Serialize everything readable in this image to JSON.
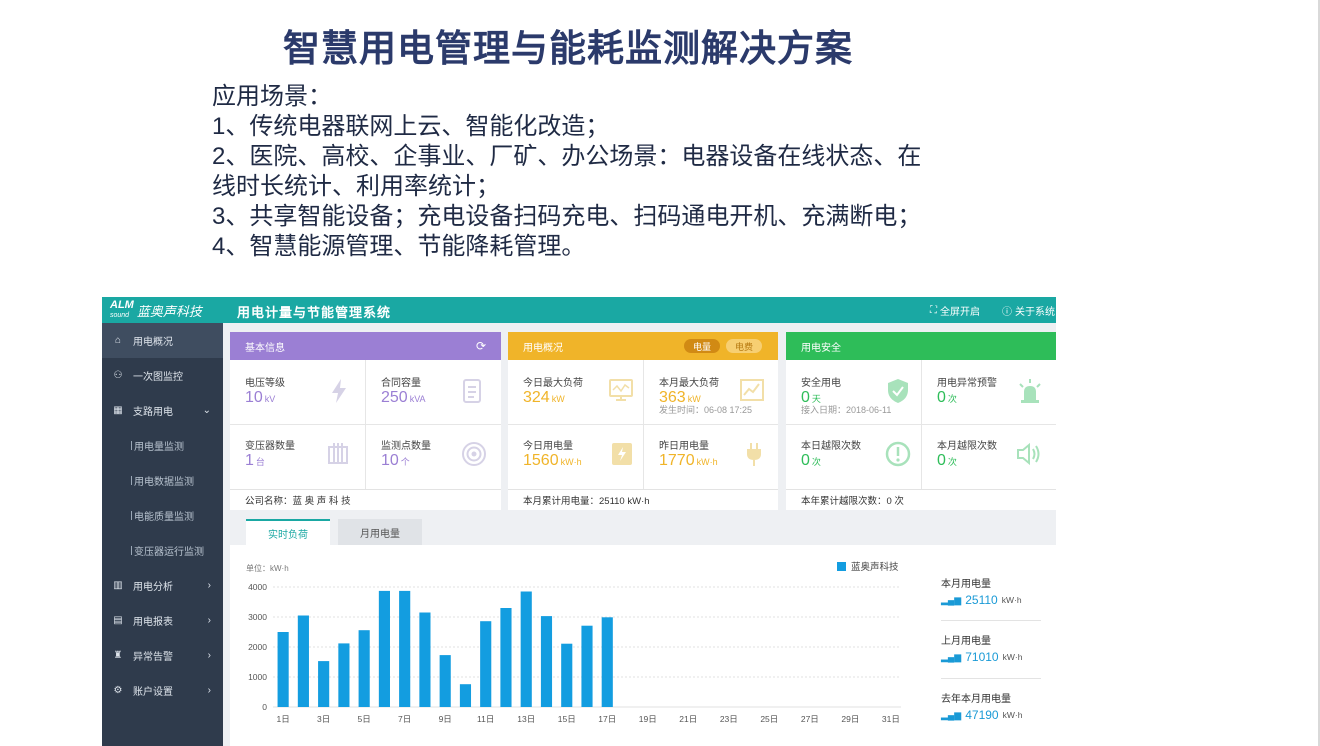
{
  "slide": {
    "title": "智慧用电管理与能耗监测解决方案",
    "lines": [
      "应用场景：",
      "1、传统电器联网上云、智能化改造；",
      "2、医院、高校、企事业、厂矿、办公场景：电器设备在线状态、在",
      "线时长统计、利用率统计；",
      "3、共享智能设备；充电设备扫码充电、扫码通电开机、充满断电；",
      "4、智慧能源管理、节能降耗管理。"
    ]
  },
  "app": {
    "brand_alm": "ALM",
    "brand_sub": "sound",
    "brand_name": "蓝奥声科技",
    "title": "用电计量与节能管理系统",
    "fullscreen": "全屏开启",
    "about": "关于系统"
  },
  "sidebar": {
    "items": [
      {
        "label": "用电概况",
        "icon": "home-icon"
      },
      {
        "label": "一次图监控",
        "icon": "diagram-icon"
      },
      {
        "label": "支路用电",
        "icon": "building-icon"
      },
      {
        "label": "用电量监测"
      },
      {
        "label": "用电数据监测"
      },
      {
        "label": "电能质量监测"
      },
      {
        "label": "变压器运行监测"
      },
      {
        "label": "用电分析",
        "icon": "bar-chart-icon"
      },
      {
        "label": "用电报表",
        "icon": "report-icon"
      },
      {
        "label": "异常告警",
        "icon": "alarm-icon"
      },
      {
        "label": "账户设置",
        "icon": "settings-icon"
      }
    ]
  },
  "basic": {
    "title": "基本信息",
    "color": "#9b7fd4",
    "voltage": {
      "label": "电压等级",
      "value": "10",
      "unit": "kV"
    },
    "contract": {
      "label": "合同容量",
      "value": "250",
      "unit": "kVA"
    },
    "transformer": {
      "label": "变压器数量",
      "value": "1",
      "unit": "台"
    },
    "points": {
      "label": "监测点数量",
      "value": "10",
      "unit": "个"
    },
    "company_label": "公司名称：",
    "company": "蓝 奥 声 科 技"
  },
  "usage": {
    "title": "用电概况",
    "color": "#f0b429",
    "pill_amount": "电量",
    "pill_fee": "电费",
    "today_max": {
      "label": "今日最大负荷",
      "value": "324",
      "unit": "kW"
    },
    "month_max": {
      "label": "本月最大负荷",
      "value": "363",
      "unit": "kW",
      "sub": "发生时间：06-08  17:25"
    },
    "today_use": {
      "label": "今日用电量",
      "value": "1560",
      "unit": "kW·h"
    },
    "yesterday_use": {
      "label": "昨日用电量",
      "value": "1770",
      "unit": "kW·h"
    },
    "footer": "本月累计用电量：25110 kW·h"
  },
  "safety": {
    "title": "用电安全",
    "color": "#2ebd59",
    "safe": {
      "label": "安全用电",
      "value": "0",
      "unit": "天",
      "sub": "接入日期：2018-06-11"
    },
    "abnormal": {
      "label": "用电异常预警",
      "value": "0",
      "unit": "次"
    },
    "day_over": {
      "label": "本日越限次数",
      "value": "0",
      "unit": "次"
    },
    "month_over": {
      "label": "本月越限次数",
      "value": "0",
      "unit": "次"
    },
    "footer": "本年累计越限次数：0 次"
  },
  "chart_tabs": {
    "realtime": "实时负荷",
    "monthly": "月用电量"
  },
  "stats": {
    "this_month": {
      "label": "本月用电量",
      "value": "25110",
      "unit": "kW·h"
    },
    "last_month": {
      "label": "上月用电量",
      "value": "71010",
      "unit": "kW·h"
    },
    "last_year": {
      "label": "去年本月用电量",
      "value": "47190",
      "unit": "kW·h"
    }
  },
  "chart_data": {
    "type": "bar",
    "ylabel": "单位：kW·h",
    "ylim": [
      0,
      4000
    ],
    "yticks": [
      0,
      1000,
      2000,
      3000,
      4000
    ],
    "grid": true,
    "legend_position": "top-right",
    "series": [
      {
        "name": "蓝奥声科技",
        "color": "#139de0",
        "values": [
          2500,
          3050,
          1530,
          2120,
          2560,
          3870,
          3870,
          3150,
          1730,
          760,
          2860,
          3300,
          3850,
          3030,
          2110,
          2710,
          2990,
          null,
          null,
          null,
          null,
          null,
          null,
          null,
          null,
          null,
          null,
          null,
          null,
          null,
          null
        ]
      }
    ],
    "categories": [
      "1日",
      "2日",
      "3日",
      "4日",
      "5日",
      "6日",
      "7日",
      "8日",
      "9日",
      "10日",
      "11日",
      "12日",
      "13日",
      "14日",
      "15日",
      "16日",
      "17日",
      "18日",
      "19日",
      "20日",
      "21日",
      "22日",
      "23日",
      "24日",
      "25日",
      "26日",
      "27日",
      "28日",
      "29日",
      "30日",
      "31日"
    ],
    "shown_xticks": [
      "1日",
      "3日",
      "5日",
      "7日",
      "9日",
      "11日",
      "13日",
      "15日",
      "17日",
      "19日",
      "21日",
      "23日",
      "25日",
      "27日",
      "29日",
      "31日"
    ]
  }
}
